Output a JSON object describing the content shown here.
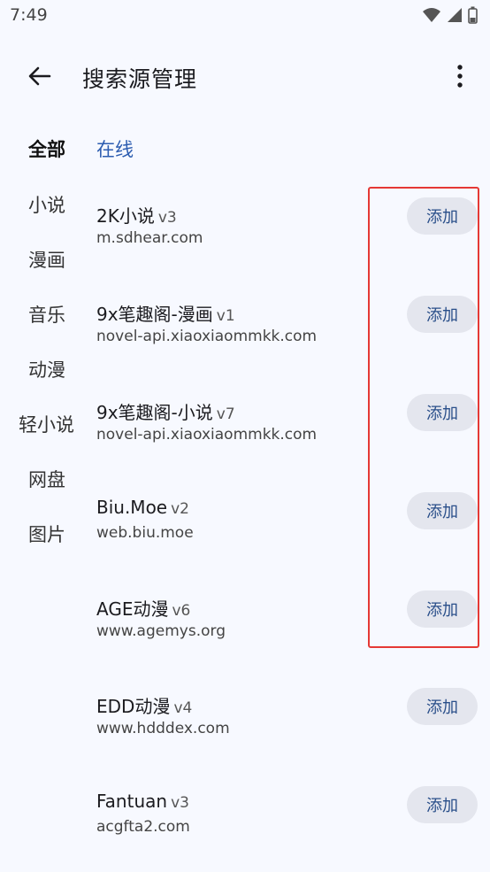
{
  "status": {
    "time": "7:49"
  },
  "header": {
    "title": "搜索源管理"
  },
  "filter": {
    "all_label": "全部",
    "online_label": "在线"
  },
  "categories": [
    "小说",
    "漫画",
    "音乐",
    "动漫",
    "轻小说",
    "网盘",
    "图片"
  ],
  "sources": [
    {
      "name": "2K小说",
      "version": "v3",
      "url": "m.sdhear.com",
      "action": "添加"
    },
    {
      "name": "9x笔趣阁-漫画",
      "version": "v1",
      "url": "novel-api.xiaoxiaommkk.com",
      "action": "添加"
    },
    {
      "name": "9x笔趣阁-小说",
      "version": "v7",
      "url": "novel-api.xiaoxiaommkk.com",
      "action": "添加"
    },
    {
      "name": "Biu.Moe",
      "version": "v2",
      "url": "web.biu.moe",
      "action": "添加"
    },
    {
      "name": "AGE动漫",
      "version": "v6",
      "url": "www.agemys.org",
      "action": "添加"
    },
    {
      "name": "EDD动漫",
      "version": "v4",
      "url": "www.hdddex.com",
      "action": "添加"
    },
    {
      "name": "Fantuan",
      "version": "v3",
      "url": "acgfta2.com",
      "action": "添加"
    }
  ],
  "icons": {
    "wifi": "wifi-icon",
    "signal": "signal-icon",
    "battery": "battery-icon",
    "back": "arrow-back-icon",
    "more": "more-vert-icon"
  },
  "colors": {
    "accent": "#2d5db0",
    "highlight": "#e53935",
    "button_bg": "#e4e6ee"
  }
}
